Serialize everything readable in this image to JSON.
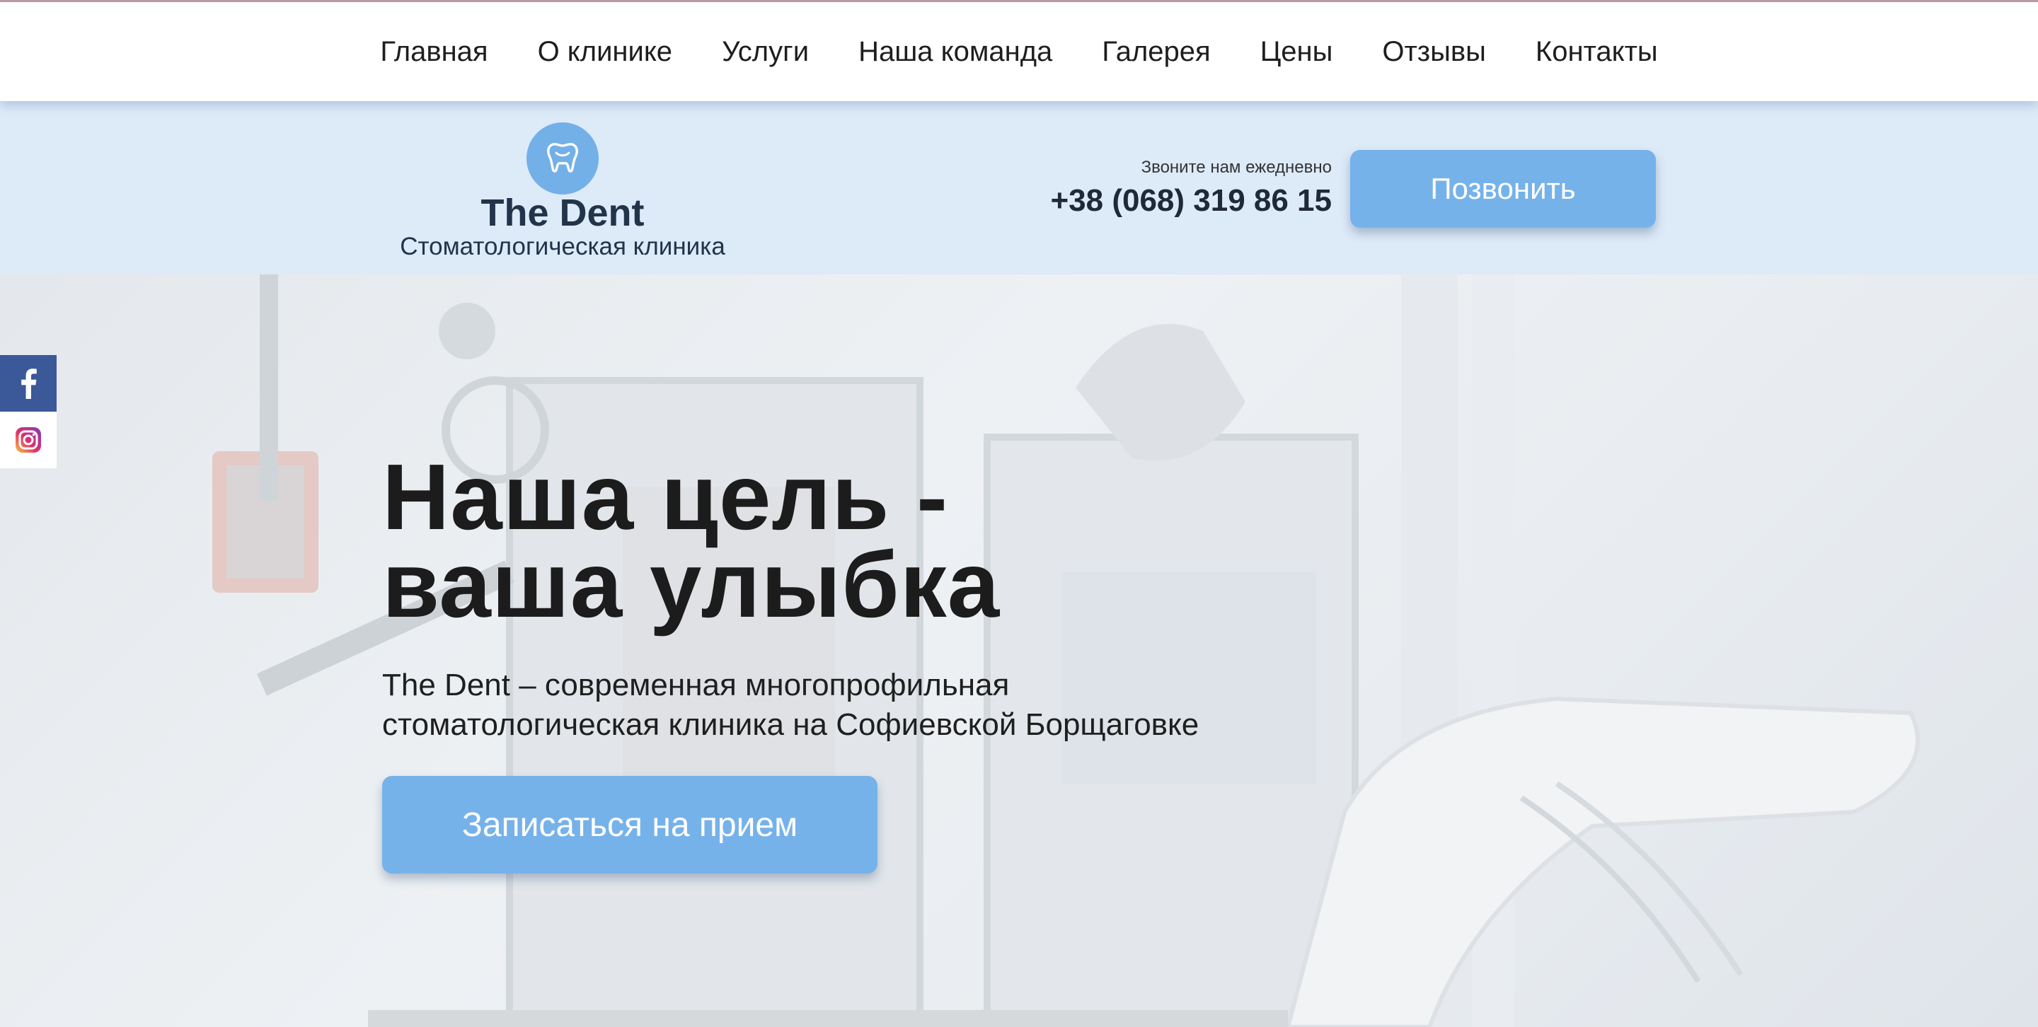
{
  "nav": {
    "items": [
      {
        "label": "Главная"
      },
      {
        "label": "О клинике"
      },
      {
        "label": "Услуги"
      },
      {
        "label": "Наша команда"
      },
      {
        "label": "Галерея"
      },
      {
        "label": "Цены"
      },
      {
        "label": "Отзывы"
      },
      {
        "label": "Контакты"
      }
    ]
  },
  "header": {
    "logo_icon": "tooth-icon",
    "logo_name": "The Dent",
    "logo_subtitle": "Стоматологическая клиника",
    "call_note": "Звоните нам ежедневно",
    "phone": "+38 (068) 319 86 15",
    "call_button": "Позвонить"
  },
  "hero": {
    "title_line1": "Наша цель -",
    "title_line2": "ваша улыбка",
    "text_line1": "The Dent – современная многопрофильная",
    "text_line2": "стоматологическая клиника на Софиевской Борщаговке",
    "cta_button": "Записаться на прием"
  },
  "social": [
    {
      "icon": "facebook-icon"
    },
    {
      "icon": "instagram-icon"
    }
  ],
  "colors": {
    "accent": "#76b2ea",
    "header_bg": "#ddeaf8",
    "facebook": "#3b5998",
    "dark_text": "#22344a"
  }
}
